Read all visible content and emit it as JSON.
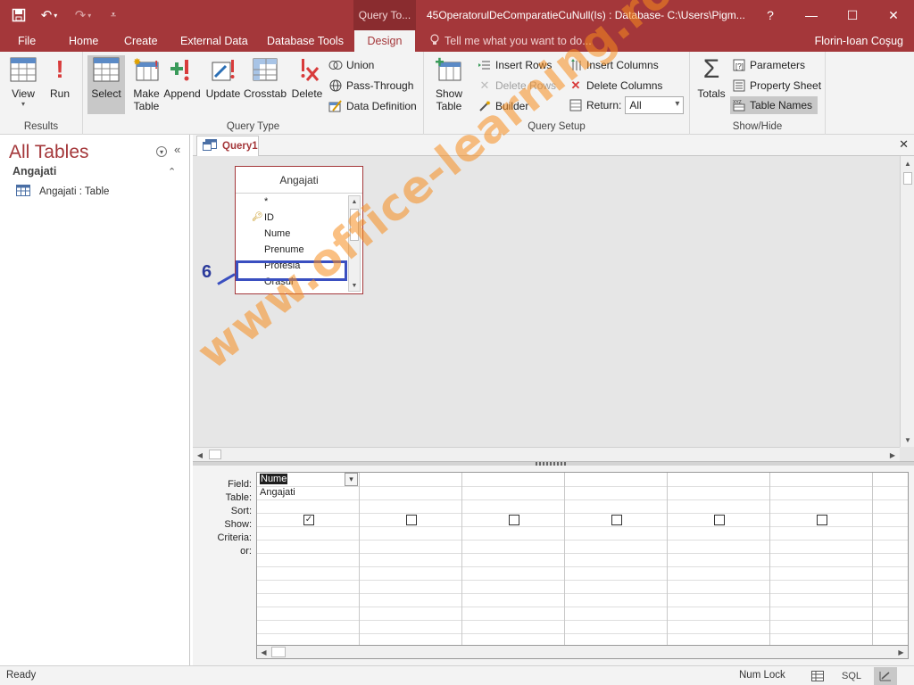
{
  "titlebar": {
    "context_tab": "Query To...",
    "document_title": "45OperatorulDeComparatieCuNull(Is) : Database- C:\\Users\\Pigm...",
    "help": "?"
  },
  "tabs": [
    "File",
    "Home",
    "Create",
    "External Data",
    "Database Tools",
    "Design"
  ],
  "active_tab": "Design",
  "tell_me": "Tell me what you want to do...",
  "username": "Florin-Ioan Coşug",
  "ribbon": {
    "results": {
      "label": "Results",
      "view": "View",
      "run": "Run"
    },
    "query_type": {
      "label": "Query Type",
      "select": "Select",
      "make_table_1": "Make",
      "make_table_2": "Table",
      "append": "Append",
      "update": "Update",
      "crosstab": "Crosstab",
      "delete": "Delete",
      "union": "Union",
      "pass_through": "Pass-Through",
      "data_definition": "Data Definition"
    },
    "query_setup": {
      "label": "Query Setup",
      "show_table_1": "Show",
      "show_table_2": "Table",
      "insert_rows": "Insert Rows",
      "delete_rows": "Delete Rows",
      "builder": "Builder",
      "insert_columns": "Insert Columns",
      "delete_columns": "Delete Columns",
      "return_label": "Return:",
      "return_value": "All"
    },
    "show_hide": {
      "label": "Show/Hide",
      "totals": "Totals",
      "parameters": "Parameters",
      "property_sheet": "Property Sheet",
      "table_names": "Table Names"
    }
  },
  "nav": {
    "title": "All Tables",
    "group": "Angajati",
    "item": "Angajati : Table"
  },
  "document": {
    "tab": "Query1",
    "table": {
      "name": "Angajati",
      "fields": [
        "*",
        "ID",
        "Nume",
        "Prenume",
        "Profesia",
        "Orasul"
      ]
    },
    "callout_number": "6",
    "grid": {
      "row_labels": [
        "Field:",
        "Table:",
        "Sort:",
        "Show:",
        "Criteria:",
        "or:"
      ],
      "field": "Nume",
      "table": "Angajati"
    }
  },
  "statusbar": {
    "status": "Ready",
    "num_lock": "Num Lock",
    "sql": "SQL"
  },
  "watermark": "www.office-learning.ro",
  "colors": {
    "accent": "#a4373a",
    "highlight": "#3a4fc0",
    "watermark": "#f58c1e"
  }
}
